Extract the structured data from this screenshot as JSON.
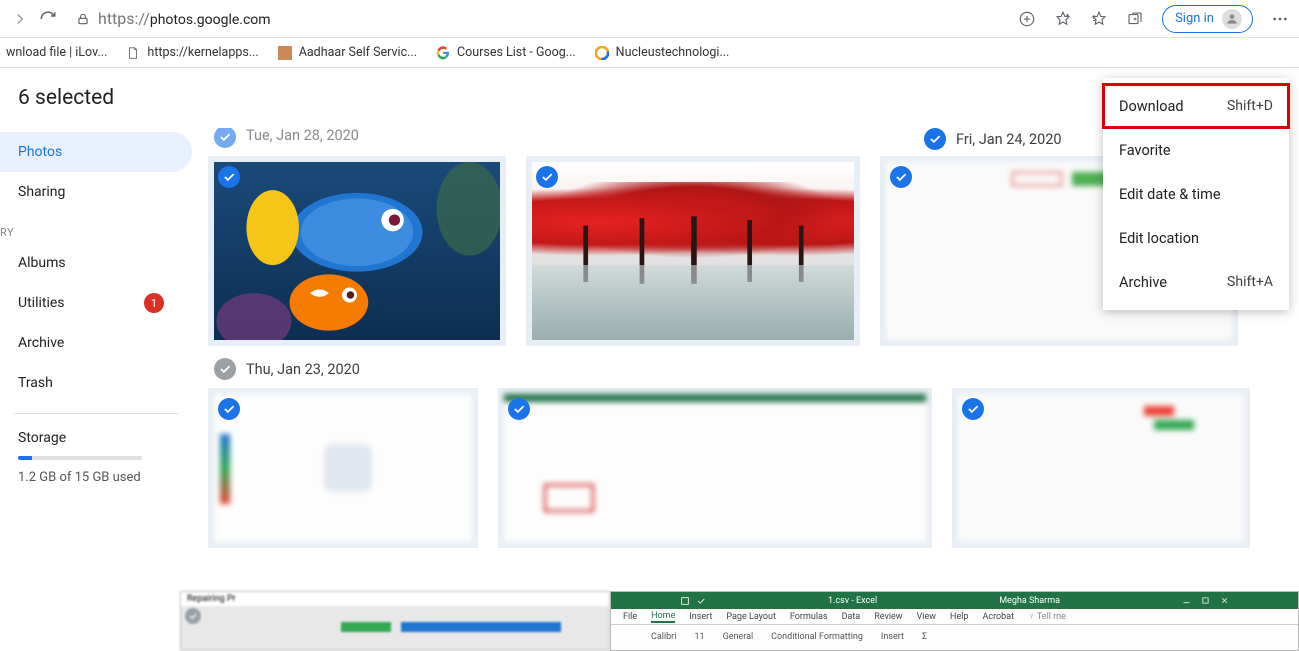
{
  "browser": {
    "url_prefix": "https://",
    "url_host": "photos.google.com",
    "sign_in": "Sign in"
  },
  "bookmarks": [
    {
      "label": "wnload file | iLov..."
    },
    {
      "label": "https://kernelapps..."
    },
    {
      "label": "Aadhaar Self Servic..."
    },
    {
      "label": "Courses List - Goog..."
    },
    {
      "label": "Nucleustechnologi..."
    }
  ],
  "header": {
    "selected": "6 selected"
  },
  "sidebar": {
    "items": [
      {
        "label": "Photos"
      },
      {
        "label": "Sharing"
      }
    ],
    "library_label": "RY",
    "library": [
      {
        "label": "Albums"
      },
      {
        "label": "Utilities",
        "badge": "1"
      },
      {
        "label": "Archive"
      },
      {
        "label": "Trash"
      }
    ],
    "storage": {
      "title": "Storage",
      "text": "1.2 GB of 15 GB used"
    }
  },
  "dates": {
    "d1": "Tue, Jan 28, 2020",
    "d2": "Fri, Jan 24, 2020",
    "d3": "Thu, Jan 23, 2020"
  },
  "context_menu": [
    {
      "label": "Download",
      "shortcut": "Shift+D"
    },
    {
      "label": "Favorite",
      "shortcut": ""
    },
    {
      "label": "Edit date & time",
      "shortcut": ""
    },
    {
      "label": "Edit location",
      "shortcut": ""
    },
    {
      "label": "Archive",
      "shortcut": "Shift+A"
    }
  ],
  "excel": {
    "title_left": "1.csv - Excel",
    "title_right": "Megha Sharma",
    "tabs": [
      "File",
      "Home",
      "Insert",
      "Page Layout",
      "Formulas",
      "Data",
      "Review",
      "View",
      "Help",
      "Acrobat",
      "Tell me"
    ],
    "ribbon": [
      "Calibri",
      "11",
      "General",
      "Conditional Formatting",
      "Insert",
      "Σ"
    ]
  },
  "repair_win": {
    "title": "Repairing Pr"
  }
}
